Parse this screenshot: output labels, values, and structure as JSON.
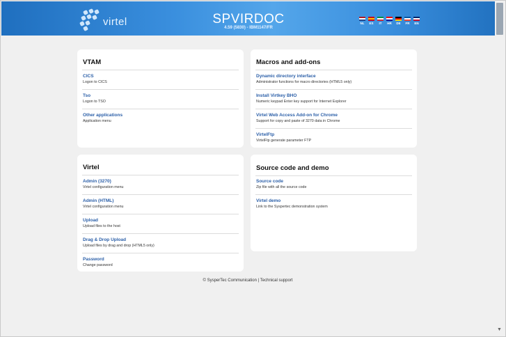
{
  "header": {
    "title": "SPVIRDOC",
    "subtitle": "4.59 (5830) - IBM1147/FR",
    "logo_text": "virtel",
    "colors": {
      "start": "#1f6fbf",
      "end": "#54a6ea"
    },
    "languages": [
      {
        "code": "NL",
        "colors": [
          "#ae1c28",
          "#ffffff",
          "#21468b"
        ]
      },
      {
        "code": "ES",
        "colors": [
          "#c60b1e",
          "#ffc400",
          "#c60b1e"
        ]
      },
      {
        "code": "IT",
        "colors": [
          "#009246",
          "#ffffff",
          "#ce2b37"
        ]
      },
      {
        "code": "HR",
        "colors": [
          "#ff0000",
          "#ffffff",
          "#171796"
        ]
      },
      {
        "code": "DE",
        "colors": [
          "#000000",
          "#dd0000",
          "#ffce00"
        ]
      },
      {
        "code": "FR",
        "colors": [
          "#0055a4",
          "#ffffff",
          "#ef4135"
        ]
      },
      {
        "code": "EN",
        "colors": [
          "#012169",
          "#ffffff",
          "#c8102e"
        ]
      }
    ]
  },
  "sections": {
    "vtam": {
      "title": "VTAM",
      "items": [
        {
          "link": "CICS",
          "desc": "Logon to CICS"
        },
        {
          "link": "Tso",
          "desc": "Logon to TSO"
        },
        {
          "link": "Other applications",
          "desc": "Application menu"
        }
      ]
    },
    "macros": {
      "title": "Macros and add-ons",
      "items": [
        {
          "link": "Dynamic directory interface",
          "desc": "Administrator functions for macro directories (HTML5 only)"
        },
        {
          "link": "Install Virtkey BHO",
          "desc": "Numeric keypad Enter key support for Internet Explorer"
        },
        {
          "link": "Virtel Web Access Add-on for Chrome",
          "desc": "Support for copy and paste of 3270 data in Chrome"
        },
        {
          "link": "VirtelFtp",
          "desc": "VirtelFtp generate parameter FTP"
        }
      ]
    },
    "virtel": {
      "title": "Virtel",
      "items": [
        {
          "link": "Admin (3270)",
          "desc": "Virtel configuration menu"
        },
        {
          "link": "Admin (HTML)",
          "desc": "Virtel configuration menu"
        },
        {
          "link": "Upload",
          "desc": "Upload files to the host"
        },
        {
          "link": "Drag & Drop Upload",
          "desc": "Upload files by drag and drop (HTML5 only)"
        },
        {
          "link": "Password",
          "desc": "Change password"
        }
      ]
    },
    "source": {
      "title": "Source code and demo",
      "items": [
        {
          "link": "Source code",
          "desc": "Zip file with all the source code"
        },
        {
          "link": "Virtel demo",
          "desc": "Link to the Syspertec demonstration system"
        }
      ]
    }
  },
  "footer": {
    "copyright": "© SysperTec Communication",
    "separator": " | ",
    "support": "Technical support"
  }
}
